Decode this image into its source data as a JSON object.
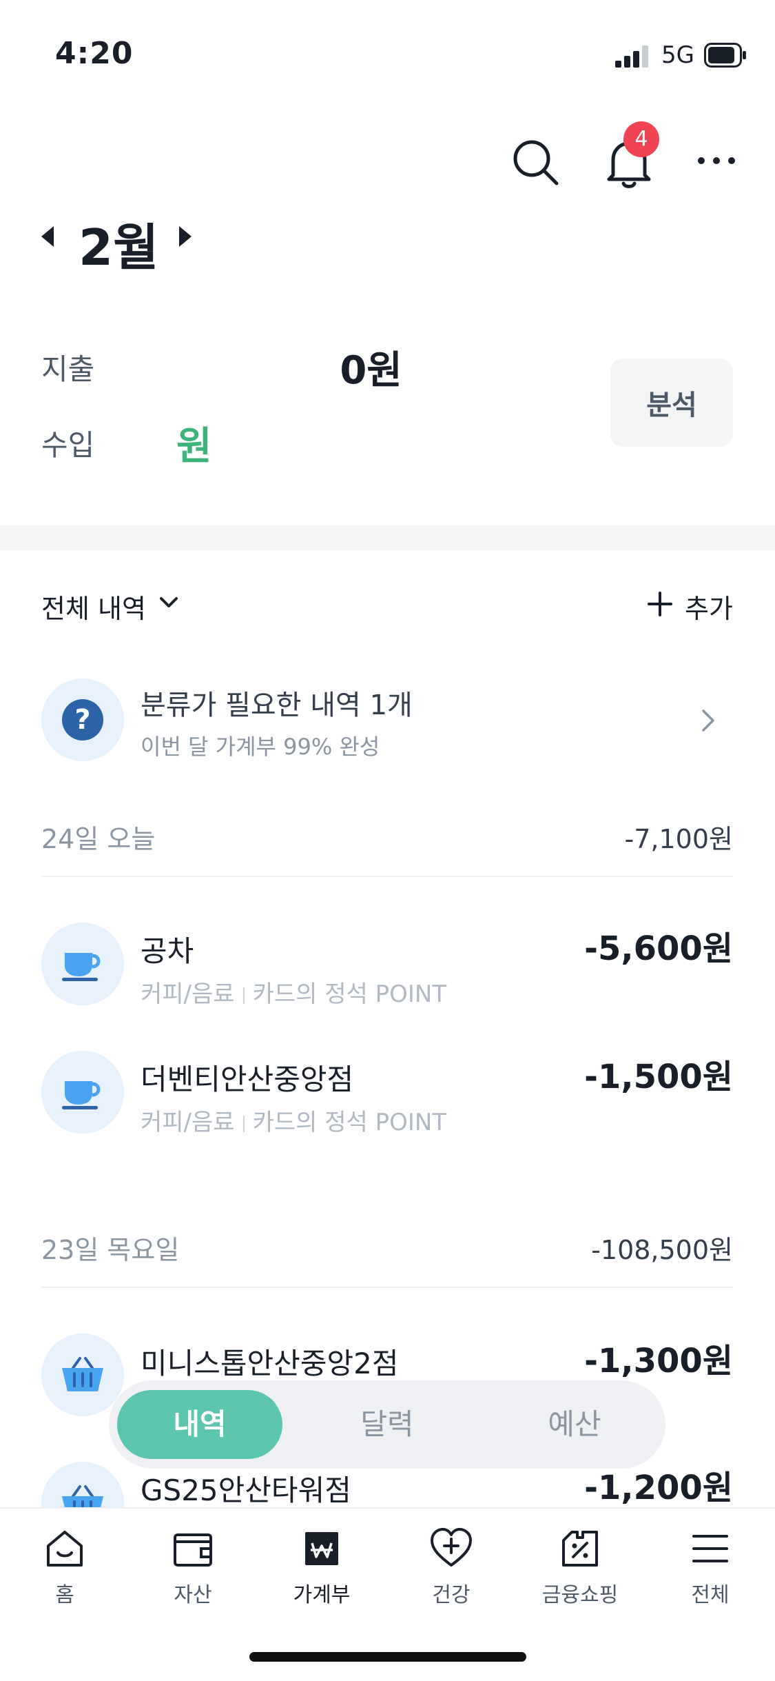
{
  "status_bar": {
    "time": "4:20",
    "network": "5G"
  },
  "header": {
    "notification_count": "4"
  },
  "month": {
    "label": "2월"
  },
  "summary": {
    "expense_label": "지출",
    "expense_value": "0원",
    "income_label": "수입",
    "income_value": "원",
    "analysis_button": "분석"
  },
  "filter": {
    "label": "전체 내역",
    "add_label": "추가"
  },
  "banner": {
    "title": "분류가 필요한 내역 1개",
    "subtitle": "이번 달 가계부 99% 완성"
  },
  "days": [
    {
      "label": "24일 오늘",
      "total": "-7,100원",
      "transactions": [
        {
          "name": "공차",
          "category": "커피/음료",
          "card": "카드의 정석 POINT",
          "amount": "-5,600원",
          "icon": "coffee-cup-icon"
        },
        {
          "name": "더벤티안산중앙점",
          "category": "커피/음료",
          "card": "카드의 정석 POINT",
          "amount": "-1,500원",
          "icon": "coffee-cup-icon"
        }
      ]
    },
    {
      "label": "23일 목요일",
      "total": "-108,500원",
      "transactions": [
        {
          "name": "미니스톱안산중앙2점",
          "amount": "-1,300원",
          "icon": "shopping-basket-icon"
        },
        {
          "name": "GS25안산타워점",
          "amount": "-1,200원",
          "icon": "shopping-basket-icon"
        }
      ]
    }
  ],
  "segment": {
    "tabs": [
      "내역",
      "달력",
      "예산"
    ],
    "active": "내역"
  },
  "bottom_nav": [
    {
      "label": "홈",
      "icon": "home-icon"
    },
    {
      "label": "자산",
      "icon": "wallet-icon"
    },
    {
      "label": "가계부",
      "icon": "ledger-won-icon",
      "active": true
    },
    {
      "label": "건강",
      "icon": "heart-plus-icon"
    },
    {
      "label": "금융쇼핑",
      "icon": "coupon-percent-icon"
    },
    {
      "label": "전체",
      "icon": "menu-icon"
    }
  ],
  "colors": {
    "accent_teal": "#5cc5b0",
    "income_green": "#3db279",
    "badge_red": "#ef4452",
    "icon_blue": "#2d64a8"
  }
}
